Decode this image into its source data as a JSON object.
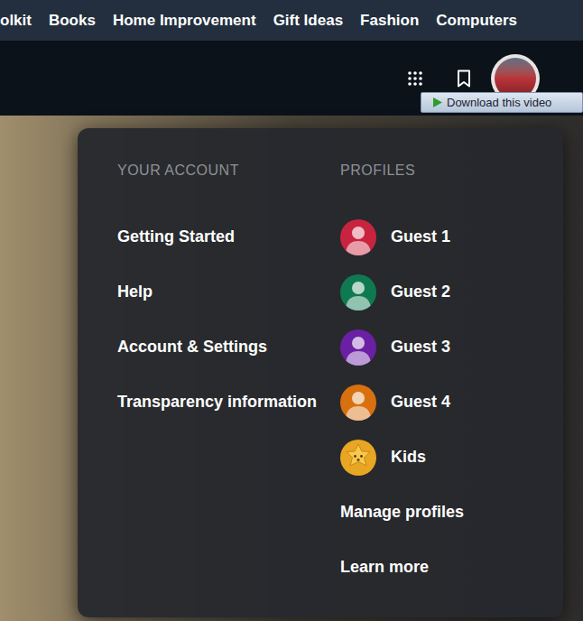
{
  "nav": {
    "items": [
      "olkit",
      "Books",
      "Home Improvement",
      "Gift Ideas",
      "Fashion",
      "Computers"
    ]
  },
  "toolbar": {
    "download_button": {
      "label": "Download this video"
    }
  },
  "account_menu": {
    "account": {
      "heading": "YOUR ACCOUNT",
      "items": [
        "Getting Started",
        "Help",
        "Account & Settings",
        "Transparency information"
      ]
    },
    "profiles": {
      "heading": "PROFILES",
      "items": [
        {
          "name": "Guest 1",
          "kind": "guest",
          "color": "#c9243f"
        },
        {
          "name": "Guest 2",
          "kind": "guest",
          "color": "#0f7a52"
        },
        {
          "name": "Guest 3",
          "kind": "guest",
          "color": "#6b1fa3"
        },
        {
          "name": "Guest 4",
          "kind": "guest",
          "color": "#d8700f"
        },
        {
          "name": "Kids",
          "kind": "kids",
          "color": "#e9a623"
        }
      ],
      "links": [
        "Manage profiles",
        "Learn more"
      ]
    }
  }
}
